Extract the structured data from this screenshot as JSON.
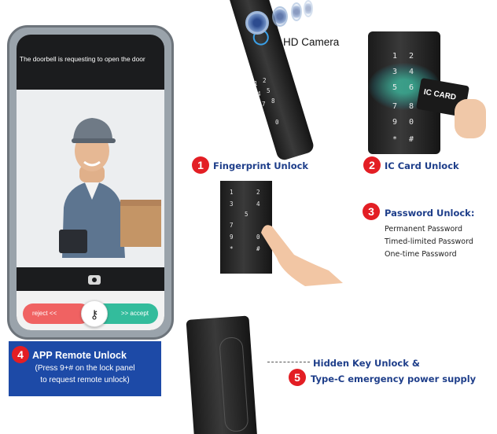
{
  "phone": {
    "notification": "The doorbell is requesting to open the door",
    "reject_label": "reject  <<",
    "accept_label": ">>  accept",
    "key_glyph": "⚷"
  },
  "features": [
    {
      "number": "1",
      "title": "Fingerprint Unlock"
    },
    {
      "number": "2",
      "title": "IC Card Unlock"
    },
    {
      "number": "3",
      "title": "Password Unlock:"
    },
    {
      "number": "4",
      "title": "APP Remote Unlock"
    },
    {
      "number": "5",
      "title": "Hidden Key Unlock &"
    }
  ],
  "app_remote": {
    "line1": "(Press 9+# on the lock panel",
    "line2": "to request remote unlock)"
  },
  "password_types": [
    "Permanent Password",
    "Timed-limited Password",
    "One-time Password"
  ],
  "camera_label": "HD Camera",
  "ic_card_label": "IC CARD",
  "typec_label": "Type-C emergency power supply",
  "keypad": {
    "keys": [
      "1",
      "2",
      "3",
      "4",
      "5",
      "6",
      "7",
      "8",
      "9",
      "0",
      "*",
      "#"
    ]
  },
  "colors": {
    "badge_red": "#e31e24",
    "label_blue": "#1e3e8a",
    "app_box_blue": "#1d4aa7",
    "reject_red": "#f06262",
    "accept_green": "#33bc9c"
  }
}
